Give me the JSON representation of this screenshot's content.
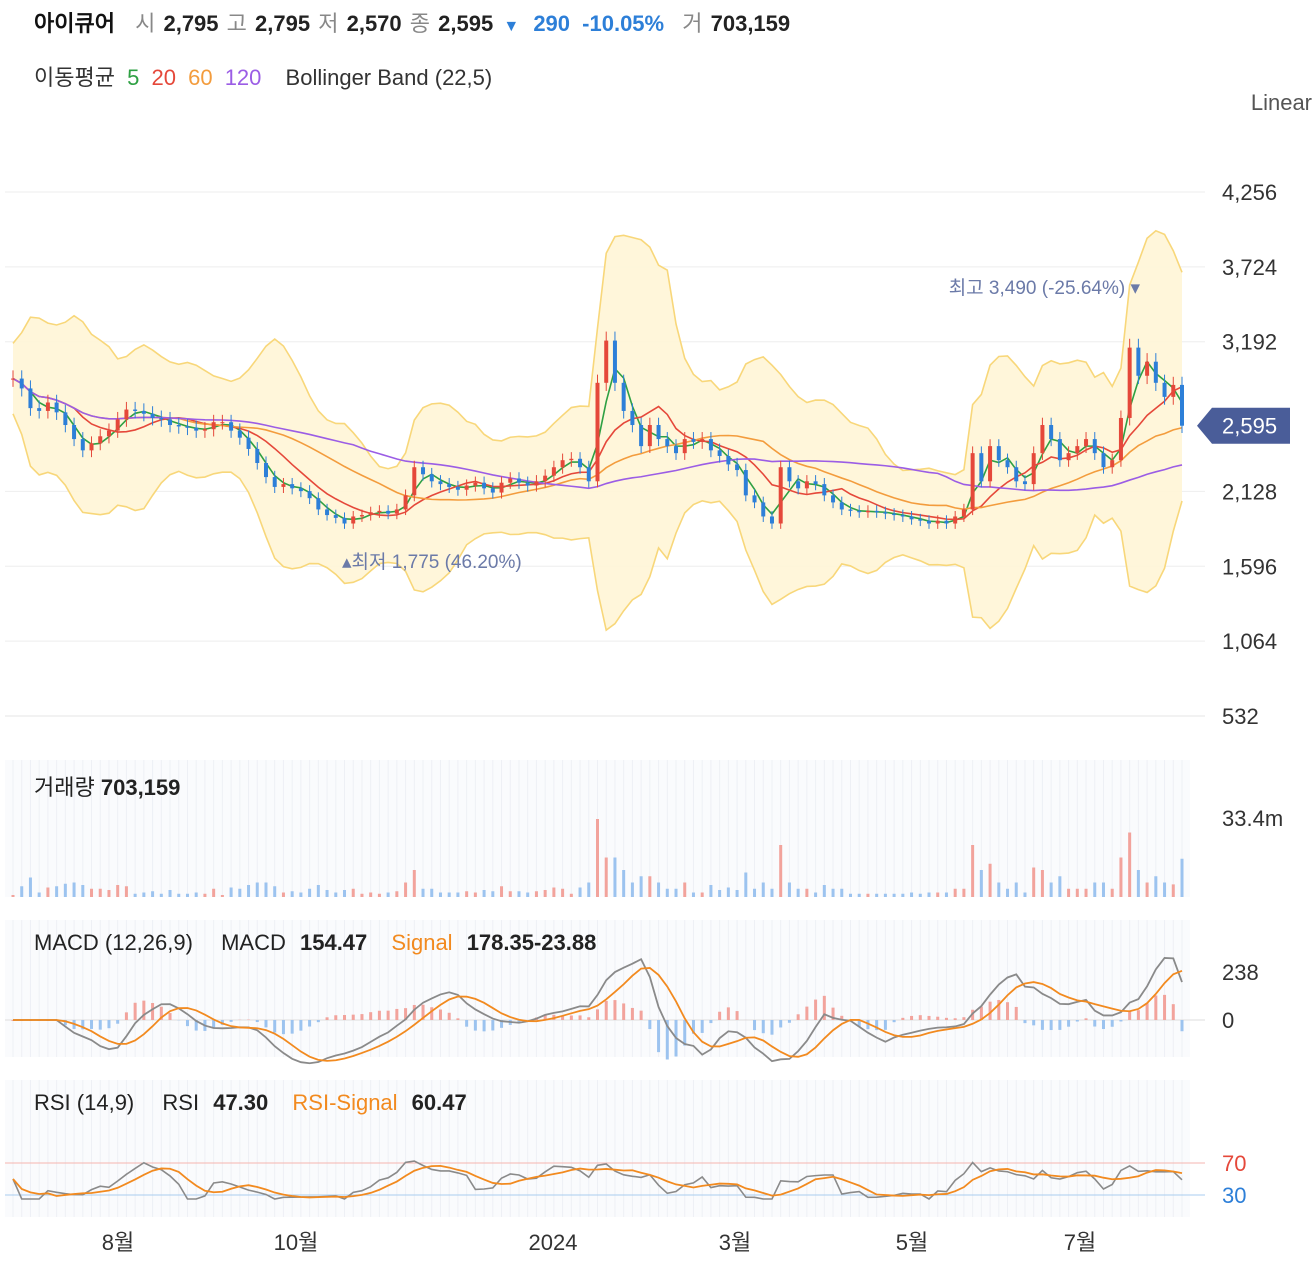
{
  "header": {
    "name": "아이큐어",
    "open_label": "시",
    "open": "2,795",
    "high_label": "고",
    "high": "2,795",
    "low_label": "저",
    "low": "2,570",
    "close_label": "종",
    "close": "2,595",
    "change_arrow": "▼",
    "change": "290",
    "change_pct": "-10.05%",
    "volume_label": "거",
    "volume": "703,159"
  },
  "indicators": {
    "ma_label": "이동평균",
    "ma5": "5",
    "ma20": "20",
    "ma60": "60",
    "ma120": "120",
    "bb": "Bollinger Band (22,5)"
  },
  "scale_mode": "Linear",
  "price_axis": [
    "4,256",
    "3,724",
    "3,192",
    "2,595",
    "2,128",
    "1,596",
    "1,064",
    "532"
  ],
  "current_price_tag": "2,595",
  "annotations": {
    "high_label": "최고",
    "high_value": "3,490 (-25.64%)",
    "low_label": "최저",
    "low_value": "1,775 (46.20%)"
  },
  "volume_panel": {
    "label": "거래량",
    "value": "703,159",
    "axis": "33.4m"
  },
  "macd_panel": {
    "label": "MACD (12,26,9)",
    "macd_label": "MACD",
    "macd_value": "154.47",
    "signal_label": "Signal",
    "signal_value": "178.35-23.88",
    "axis": [
      "238",
      "0"
    ]
  },
  "rsi_panel": {
    "label": "RSI (14,9)",
    "rsi_label": "RSI",
    "rsi_value": "47.30",
    "signal_label": "RSI-Signal",
    "signal_value": "60.47",
    "axis": [
      "70",
      "30"
    ]
  },
  "time_axis": [
    "8월",
    "10월",
    "2024",
    "3월",
    "5월",
    "7월"
  ],
  "colors": {
    "up": "#e5483a",
    "down": "#2d7fd8",
    "bb_fill": "#fff5d6",
    "bb_line": "#f8d77a",
    "ma5": "#2ea043",
    "ma20": "#e5483a",
    "ma60": "#f39c3d",
    "ma120": "#9b5de5",
    "macd": "#8a8a8a",
    "signal": "#f28a1f",
    "price_tag": "#4a5d99"
  },
  "chart_data": {
    "type": "candlestick",
    "price_range": [
      532,
      4400
    ],
    "price_ticks": [
      532,
      1064,
      1596,
      2128,
      2595,
      3192,
      3724,
      4256
    ],
    "closes": [
      2930,
      2860,
      2720,
      2700,
      2760,
      2690,
      2600,
      2500,
      2420,
      2470,
      2520,
      2560,
      2640,
      2710,
      2700,
      2680,
      2650,
      2640,
      2600,
      2590,
      2580,
      2560,
      2570,
      2620,
      2620,
      2560,
      2510,
      2430,
      2330,
      2230,
      2160,
      2180,
      2150,
      2130,
      2080,
      2000,
      1960,
      1940,
      1900,
      1950,
      1960,
      1980,
      1990,
      1970,
      2000,
      2100,
      2300,
      2250,
      2200,
      2180,
      2160,
      2140,
      2170,
      2190,
      2150,
      2120,
      2190,
      2220,
      2190,
      2170,
      2200,
      2240,
      2300,
      2350,
      2360,
      2300,
      2200,
      2900,
      3200,
      2900,
      2700,
      2600,
      2450,
      2600,
      2500,
      2450,
      2400,
      2500,
      2480,
      2500,
      2420,
      2380,
      2320,
      2280,
      2100,
      2050,
      1950,
      1900,
      2300,
      2200,
      2150,
      2200,
      2180,
      2100,
      2050,
      2000,
      1990,
      1980,
      1990,
      1980,
      1970,
      1960,
      1950,
      1930,
      1920,
      1900,
      1920,
      1900,
      1950,
      2000,
      2400,
      2200,
      2450,
      2350,
      2300,
      2200,
      2180,
      2400,
      2600,
      2500,
      2350,
      2400,
      2450,
      2500,
      2400,
      2300,
      2350,
      2650,
      3150,
      2950,
      3050,
      2900,
      2800,
      2885,
      2595
    ],
    "high": 3490,
    "low": 1775,
    "last": {
      "open": 2795,
      "high": 2795,
      "low": 2570,
      "close": 2595,
      "volume": 703159
    },
    "macd": {
      "macd": 154.47,
      "signal": 178.35,
      "histogram": -23.88
    },
    "rsi": {
      "rsi": 47.3,
      "signal": 60.47,
      "levels": [
        70,
        30
      ]
    }
  }
}
